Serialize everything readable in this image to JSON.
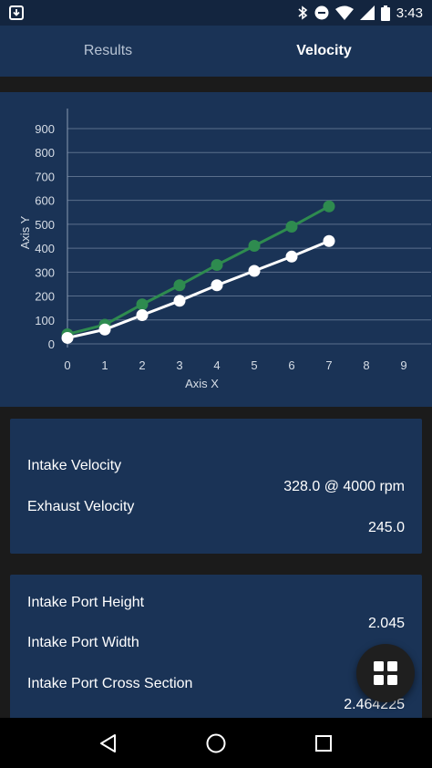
{
  "status_bar": {
    "time": "3:43",
    "icons": [
      "download-icon",
      "bluetooth-icon",
      "do-not-disturb-icon",
      "wifi-icon",
      "signal-icon",
      "battery-icon"
    ]
  },
  "tabs": [
    {
      "label": "Results",
      "active": false
    },
    {
      "label": "Velocity",
      "active": true
    }
  ],
  "chart_data": {
    "type": "line",
    "xlabel": "Axis X",
    "ylabel": "Axis Y",
    "xlim": [
      0,
      9
    ],
    "ylim": [
      0,
      900
    ],
    "x_ticks": [
      "0",
      "1",
      "2",
      "3",
      "4",
      "5",
      "6",
      "7",
      "8",
      "9"
    ],
    "y_ticks": [
      "0",
      "100",
      "200",
      "300",
      "400",
      "500",
      "600",
      "700",
      "800",
      "900"
    ],
    "grid": "horizontal",
    "legend": "none",
    "series": [
      {
        "color": "#2e8b4f",
        "x": [
          0,
          1,
          2,
          3,
          4,
          5,
          6,
          7
        ],
        "y": [
          40,
          80,
          165,
          245,
          330,
          410,
          490,
          575
        ]
      },
      {
        "color": "#ffffff",
        "x": [
          0,
          1,
          2,
          3,
          4,
          5,
          6,
          7
        ],
        "y": [
          25,
          60,
          120,
          180,
          245,
          305,
          365,
          430
        ]
      }
    ]
  },
  "velocity_card": {
    "intake_label": "Intake Velocity",
    "intake_value": "328.0 @ 4000 rpm",
    "exhaust_label": "Exhaust Velocity",
    "exhaust_value": "245.0"
  },
  "port_card": {
    "height_label": "Intake Port Height",
    "height_value": "2.045",
    "width_label": "Intake Port Width",
    "cross_label": "Intake Port Cross Section",
    "cross_value": "2.464225"
  },
  "fab": {
    "icon": "grid-icon"
  },
  "nav": {
    "icons": [
      "back-icon",
      "home-icon",
      "recents-icon"
    ]
  },
  "colors": {
    "background": "#1b1b1b",
    "card": "#1a3356",
    "statusbar": "#13253f",
    "series_green": "#2e8b4f"
  }
}
